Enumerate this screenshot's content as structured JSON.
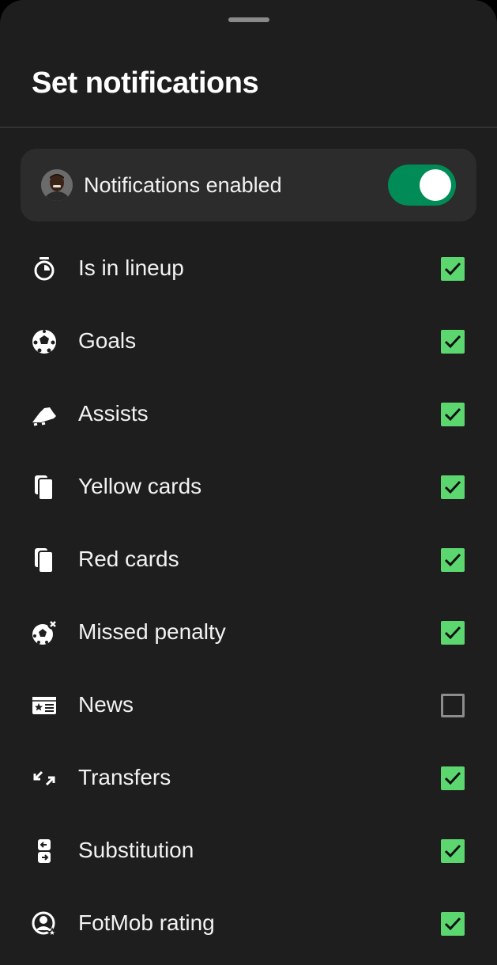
{
  "title": "Set notifications",
  "master": {
    "label": "Notifications enabled",
    "enabled": true
  },
  "colors": {
    "accent_toggle": "#008b57",
    "checkbox_checked": "#5cd66f",
    "background": "#1e1e1e"
  },
  "items": [
    {
      "label": "Is in lineup",
      "icon": "stopwatch-icon",
      "checked": true
    },
    {
      "label": "Goals",
      "icon": "football-icon",
      "checked": true
    },
    {
      "label": "Assists",
      "icon": "boot-icon",
      "checked": true
    },
    {
      "label": "Yellow cards",
      "icon": "cards-icon",
      "checked": true
    },
    {
      "label": "Red cards",
      "icon": "cards-icon",
      "checked": true
    },
    {
      "label": "Missed penalty",
      "icon": "missed-ball-icon",
      "checked": true
    },
    {
      "label": "News",
      "icon": "news-icon",
      "checked": false
    },
    {
      "label": "Transfers",
      "icon": "transfer-arrows-icon",
      "checked": true
    },
    {
      "label": "Substitution",
      "icon": "substitution-icon",
      "checked": true
    },
    {
      "label": "FotMob rating",
      "icon": "rating-icon",
      "checked": true
    }
  ]
}
